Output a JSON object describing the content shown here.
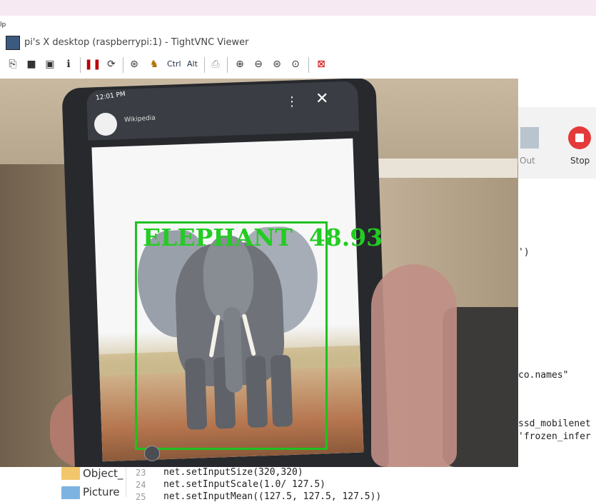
{
  "host": {
    "menu_fragment": "lp"
  },
  "vnc": {
    "title": "pi's X desktop (raspberrypi:1) - TightVNC Viewer",
    "toolbar": {
      "ctrl_label": "Ctrl",
      "alt_label": "Alt",
      "icons": [
        "new-connection-icon",
        "save-icon",
        "options-icon",
        "info-icon",
        "pause-icon",
        "refresh-icon",
        "ctrl-alt-del-icon",
        "send-key-icon",
        "clipboard-icon",
        "zoom-in-icon",
        "zoom-out-icon",
        "zoom-100-icon",
        "zoom-fit-icon",
        "fullscreen-icon"
      ]
    }
  },
  "thonny": {
    "zoomout_label": "Out",
    "stop_label": "Stop",
    "code_fragments": [
      "')",
      "co.names\"",
      "ssd_mobilenet",
      "'frozen_infer"
    ]
  },
  "files": [
    {
      "label": "Object_"
    },
    {
      "label": "Picture"
    }
  ],
  "editor": {
    "lines": [
      {
        "num": "23",
        "text": "net.setInputSize(320,320)"
      },
      {
        "num": "24",
        "text": "net.setInputScale(1.0/ 127.5)"
      },
      {
        "num": "25",
        "text": "net.setInputMean((127.5, 127.5, 127.5))"
      }
    ]
  },
  "camera": {
    "phone_time": "12:01 PM",
    "phone_username": "Wikipedia",
    "detection": {
      "label": "ELEPHANT",
      "score": "48.93",
      "color": "#22cc22"
    }
  },
  "colors": {
    "box_green": "#20c020",
    "stop_red": "#e43a3a"
  }
}
